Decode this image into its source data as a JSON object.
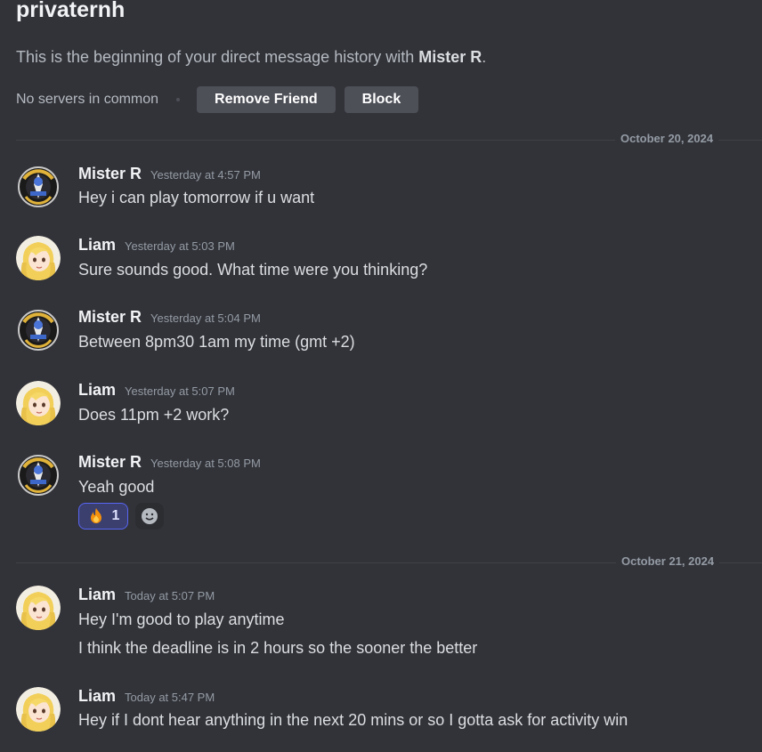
{
  "channel": {
    "title": "privaternh",
    "intro_prefix": "This is the beginning of your direct message history with ",
    "intro_name": "Mister R",
    "intro_suffix": "."
  },
  "actions": {
    "no_servers": "No servers in common",
    "remove_friend": "Remove Friend",
    "block": "Block"
  },
  "dividers": [
    "October 20, 2024",
    "October 21, 2024"
  ],
  "messages": [
    {
      "author": "Mister R",
      "time": "Yesterday at 4:57 PM",
      "lines": [
        "Hey i can play tomorrow if u want"
      ]
    },
    {
      "author": "Liam",
      "time": "Yesterday at 5:03 PM",
      "lines": [
        "Sure sounds good. What time were you thinking?"
      ]
    },
    {
      "author": "Mister R",
      "time": "Yesterday at 5:04 PM",
      "lines": [
        "Between 8pm30 1am my time (gmt +2)"
      ]
    },
    {
      "author": "Liam",
      "time": "Yesterday at 5:07 PM",
      "lines": [
        "Does 11pm +2 work?"
      ]
    },
    {
      "author": "Mister R",
      "time": "Yesterday at 5:08 PM",
      "lines": [
        "Yeah good"
      ],
      "reaction": {
        "emoji": "fire-icon",
        "count": "1"
      }
    },
    {
      "author": "Liam",
      "time": "Today at 5:07 PM",
      "lines": [
        "Hey I'm good to play anytime",
        "I think the deadline is in 2 hours so the sooner the better"
      ]
    },
    {
      "author": "Liam",
      "time": "Today at 5:47 PM",
      "lines": [
        "Hey if I dont hear anything in the next 20 mins or so I gotta ask for activity win"
      ]
    }
  ],
  "colors": {
    "background": "#323339",
    "button": "#4e5058",
    "reaction_border": "#5865f2"
  }
}
